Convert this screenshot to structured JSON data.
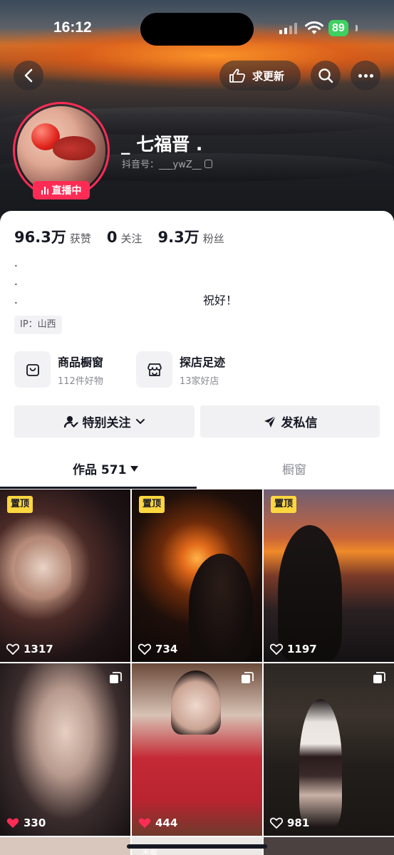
{
  "status_bar": {
    "time": "16:12",
    "battery": "89"
  },
  "nav": {
    "update_request_label": "求更新"
  },
  "profile": {
    "nickname": "_ 七福晋 .",
    "douyin_id": "抖音号：___ywZ__",
    "live_label": "直播中"
  },
  "stats": [
    {
      "value": "96.3万",
      "caption": "获赞"
    },
    {
      "value": "0",
      "caption": "关注"
    },
    {
      "value": "9.3万",
      "caption": "粉丝"
    }
  ],
  "bio": {
    "lines": [
      ".",
      ".",
      "."
    ],
    "signoff": "祝好！"
  },
  "ip_tag": "IP：山西",
  "shop_cards": [
    {
      "title": "商品橱窗",
      "subtitle": "112件好物",
      "icon": "shopping-bag-icon"
    },
    {
      "title": "探店足迹",
      "subtitle": "13家好店",
      "icon": "storefront-icon"
    }
  ],
  "actions": {
    "follow_label": "特别关注",
    "message_label": "发私信"
  },
  "tabs": {
    "works_label": "作品 571",
    "shop_label": "橱窗"
  },
  "grid": [
    {
      "pinned": "置顶",
      "likes": "1317",
      "liked": false
    },
    {
      "pinned": "置顶",
      "likes": "734",
      "liked": false
    },
    {
      "pinned": "置顶",
      "likes": "1197",
      "liked": false
    },
    {
      "likes": "330",
      "liked": true
    },
    {
      "likes": "444",
      "liked": true
    },
    {
      "likes": "981",
      "liked": false
    }
  ],
  "partial_row_label": "未看",
  "colors": {
    "accent": "#fe2c55",
    "pin": "#fed640",
    "battery": "#3ed160"
  }
}
